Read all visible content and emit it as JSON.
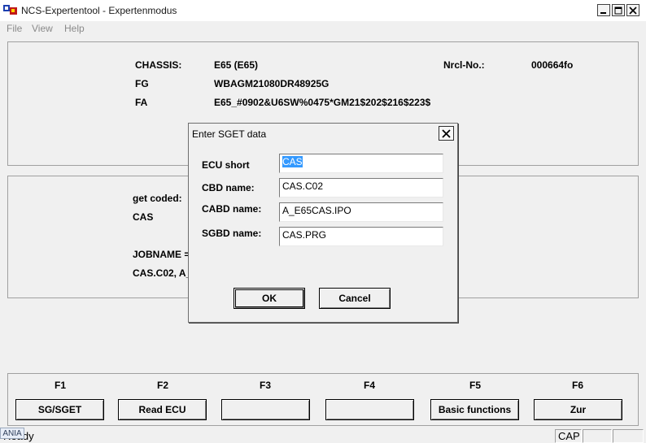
{
  "window": {
    "title": "NCS-Expertentool - Expertenmodus"
  },
  "menu": {
    "file": "File",
    "view": "View",
    "help": "Help"
  },
  "vehicle": {
    "chassis_label": "CHASSIS:",
    "chassis_value": "E65 (E65)",
    "nrcl_label": "Nrcl-No.:",
    "nrcl_value": "000664fo",
    "fg_label": "FG",
    "fg_value": "WBAGM21080DR48925G",
    "fa_label": "FA",
    "fa_value": "E65_#0902&U6SW%0475*GM21$202$216$223$"
  },
  "job": {
    "get_coded_label": "get coded:",
    "ecu_value": "CAS",
    "jobname_label": "JOBNAME =",
    "files_value": "CAS.C02, A_"
  },
  "fkeys": [
    {
      "key": "F1",
      "button": "SG/SGET"
    },
    {
      "key": "F2",
      "button": "Read ECU"
    },
    {
      "key": "F3",
      "button": ""
    },
    {
      "key": "F4",
      "button": ""
    },
    {
      "key": "F5",
      "button": "Basic functions"
    },
    {
      "key": "F6",
      "button": "Zur"
    }
  ],
  "status": {
    "text": "Ready",
    "overlay": "ANIA",
    "cap": "CAP"
  },
  "dialog": {
    "title": "Enter SGET data",
    "ecu_short_label": "ECU short",
    "ecu_short_value": "CAS",
    "cbd_label": "CBD name:",
    "cbd_value": "CAS.C02",
    "cabd_label": "CABD name:",
    "cabd_value": "A_E65CAS.IPO",
    "sgbd_label": "SGBD name:",
    "sgbd_value": "CAS.PRG",
    "ok_label": "OK",
    "cancel_label": "Cancel"
  }
}
